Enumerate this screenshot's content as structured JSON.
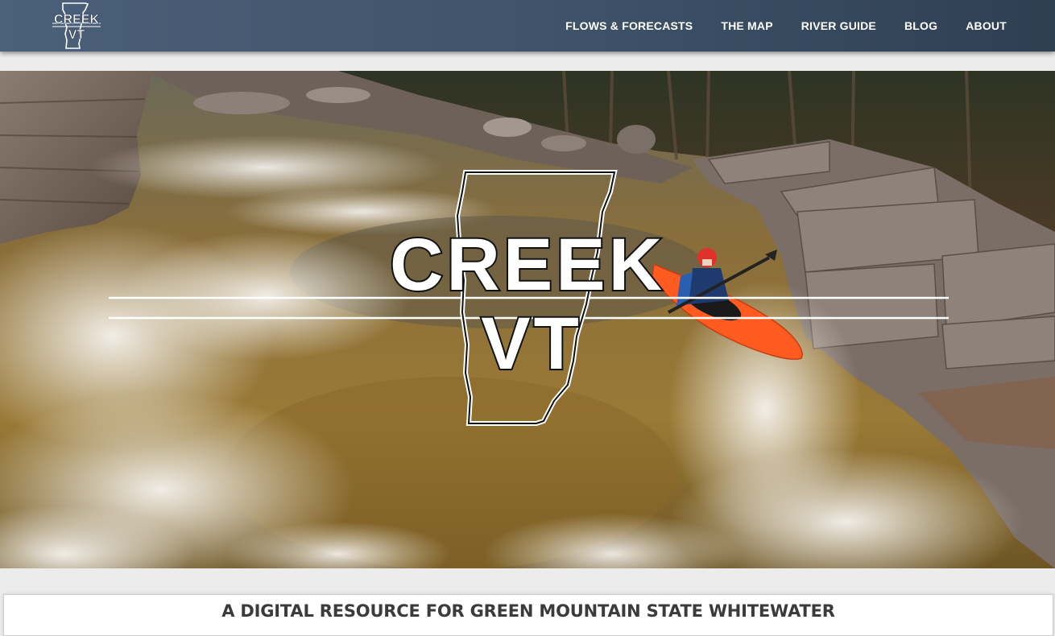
{
  "site": {
    "logo_text_line1": "CREEK",
    "logo_text_line2": "VT"
  },
  "nav": {
    "items": [
      {
        "label": "FLOWS & FORECASTS"
      },
      {
        "label": "THE MAP"
      },
      {
        "label": "RIVER GUIDE"
      },
      {
        "label": "BLOG"
      },
      {
        "label": "ABOUT"
      }
    ]
  },
  "hero": {
    "logo_line1": "CREEK",
    "logo_line2": "VT"
  },
  "tagline": "A DIGITAL RESOURCE FOR GREEN MOUNTAIN STATE WHITEWATER",
  "colors": {
    "nav_bg": "#43566c",
    "kayak": "#ff5a1f",
    "helmet": "#e0322b",
    "water_brown": "#8a6a2c"
  }
}
